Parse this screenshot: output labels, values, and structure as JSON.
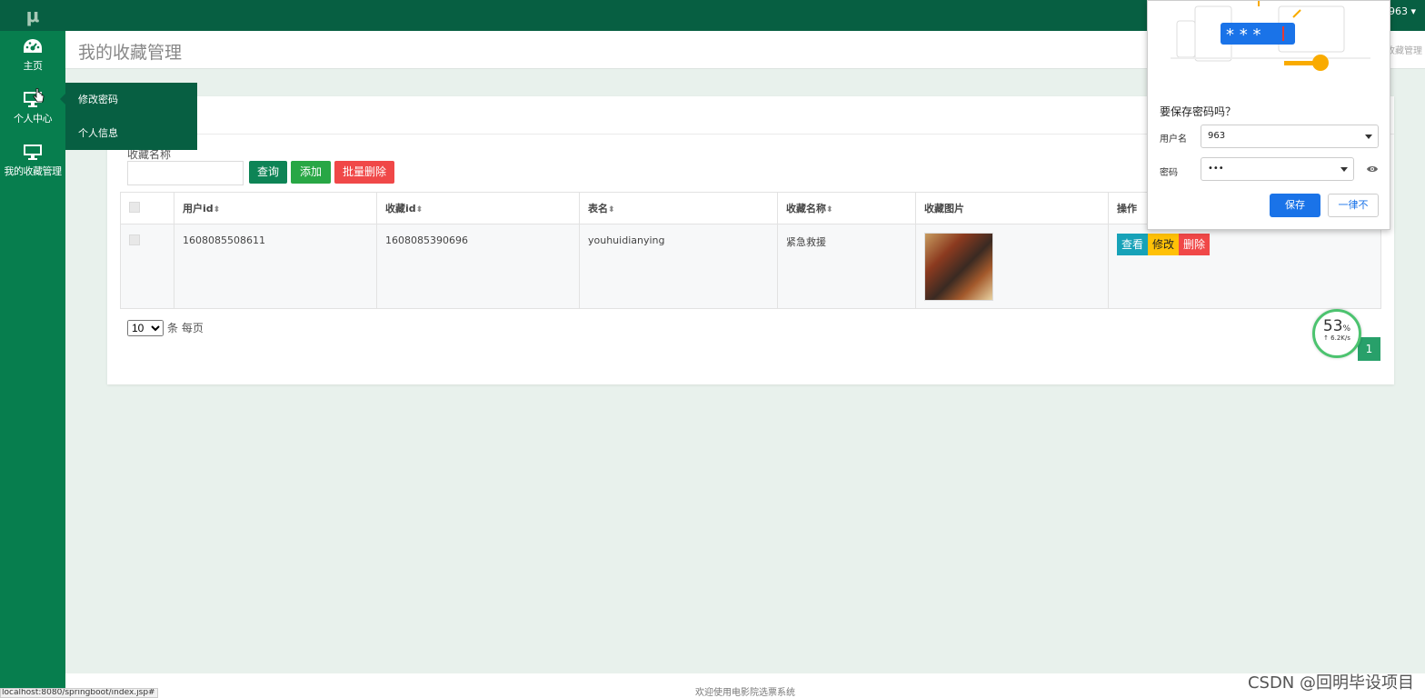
{
  "sidebar": {
    "logo": "μ",
    "items": [
      {
        "label": "主页",
        "icon": "dashboard-icon"
      },
      {
        "label": "个人中心",
        "icon": "monitor-icon"
      },
      {
        "label": "我的收藏管理",
        "icon": "monitor-icon"
      }
    ]
  },
  "topbar": {
    "user": "963 ▾"
  },
  "header": {
    "title": "我的收藏管理",
    "breadcrumb": "收藏管理"
  },
  "submenu": {
    "items": [
      "修改密码",
      "个人信息"
    ]
  },
  "search": {
    "label": "收藏名称",
    "query_btn": "查询",
    "add_btn": "添加",
    "batch_delete_btn": "批量删除"
  },
  "table": {
    "headers": [
      "用户id",
      "收藏id",
      "表名",
      "收藏名称",
      "收藏图片",
      "操作"
    ],
    "rows": [
      {
        "user_id": "1608085508611",
        "fav_id": "1608085390696",
        "table_name": "youhuidianying",
        "fav_name": "紧急救援"
      }
    ],
    "actions": {
      "view": "查看",
      "edit": "修改",
      "delete": "删除"
    }
  },
  "pager": {
    "size": "10",
    "suffix": "条 每页",
    "page": "1"
  },
  "speed": {
    "percent": "53",
    "percent_sign": "%",
    "rate": "↑ 6.2K/s",
    "fill": 0.53
  },
  "popup": {
    "question": "要保存密码吗？",
    "username_label": "用户名",
    "username_value": "963",
    "password_label": "密码",
    "password_value": "•••",
    "save_btn": "保存",
    "never_btn": "一律不"
  },
  "footer": {
    "text": "欢迎使用电影院选票系统"
  },
  "watermark": "CSDN @回明毕设项目",
  "status_url": "localhost:8080/springboot/index.jsp#",
  "colors": {
    "sidebar": "#077e4e",
    "topbar": "#075f42",
    "accent": "#1a73e8",
    "danger": "#f04848",
    "success": "#28a745"
  }
}
